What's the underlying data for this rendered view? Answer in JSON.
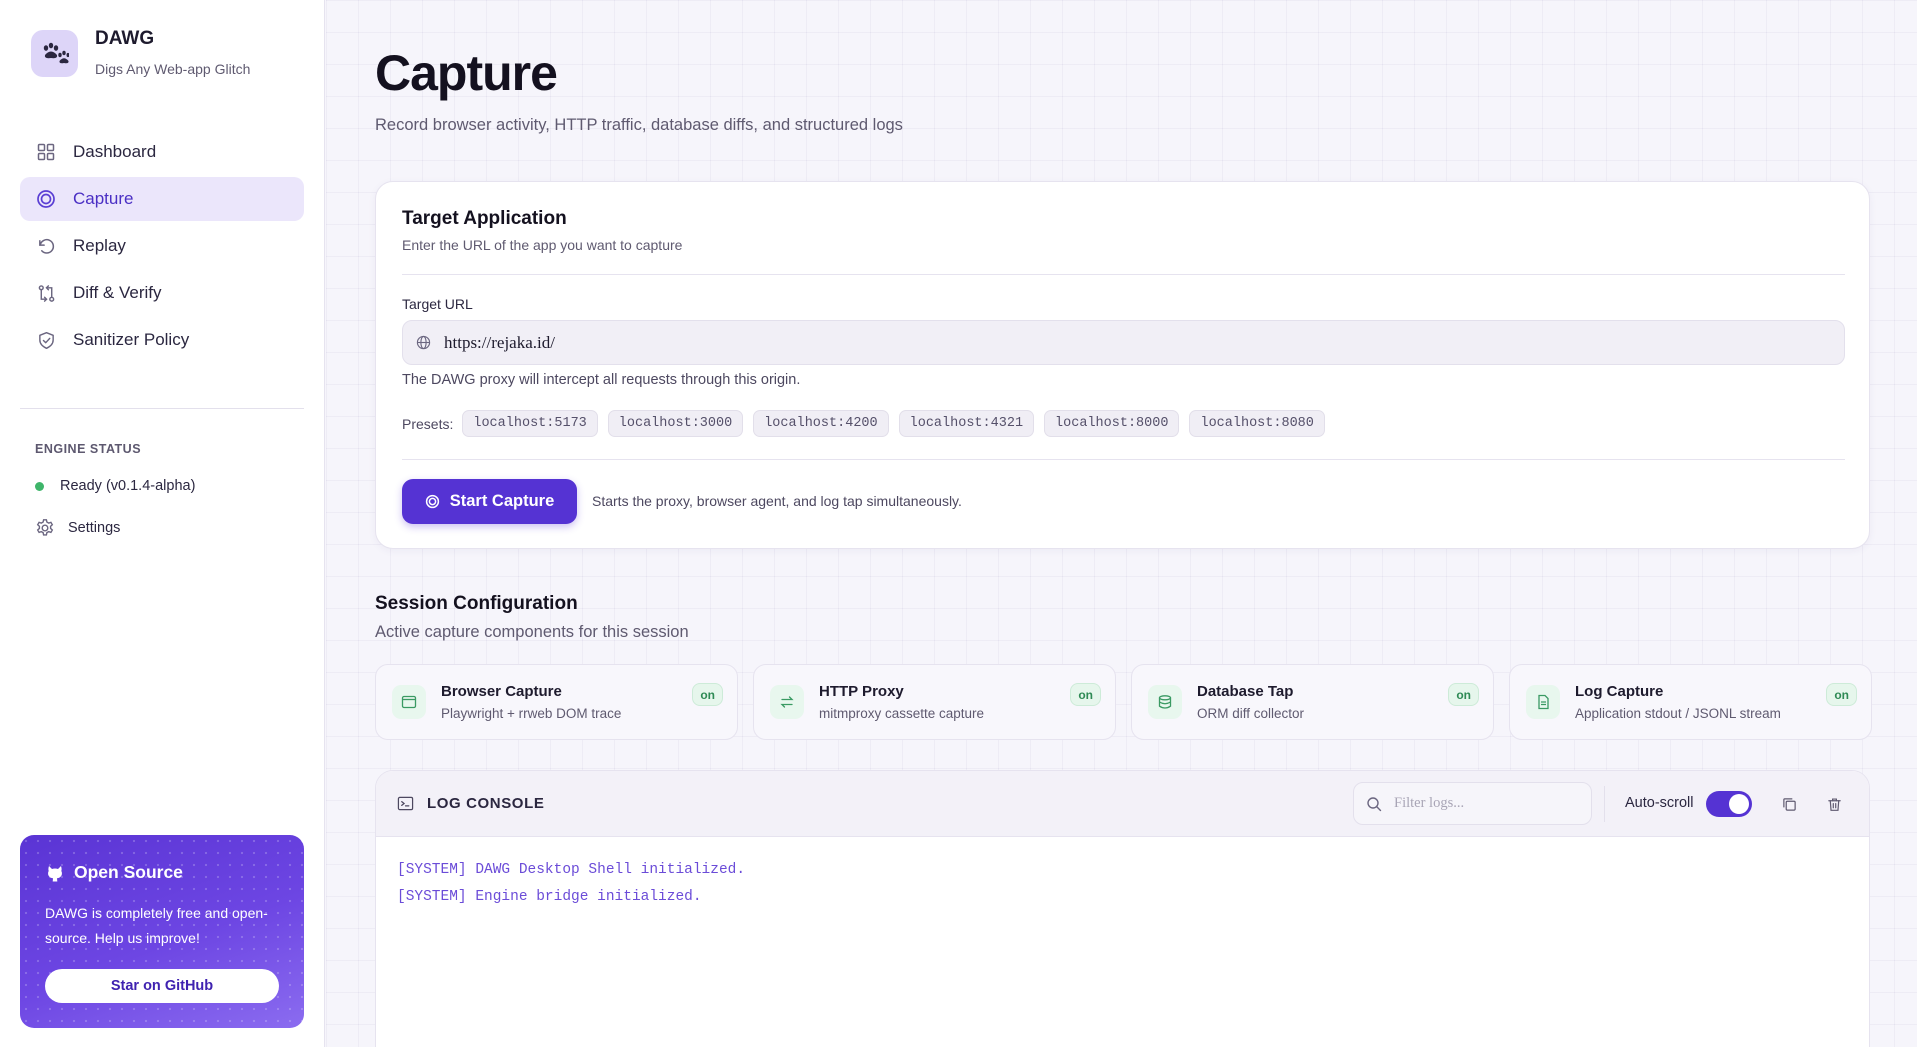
{
  "brand": {
    "name": "DAWG",
    "tagline": "Digs Any Web-app Glitch"
  },
  "nav": {
    "items": [
      {
        "label": "Dashboard",
        "icon": "grid-icon",
        "active": false
      },
      {
        "label": "Capture",
        "icon": "target-icon",
        "active": true
      },
      {
        "label": "Replay",
        "icon": "rotate-ccw-icon",
        "active": false
      },
      {
        "label": "Diff & Verify",
        "icon": "git-compare-icon",
        "active": false
      },
      {
        "label": "Sanitizer Policy",
        "icon": "shield-check-icon",
        "active": false
      }
    ]
  },
  "engine": {
    "title": "ENGINE STATUS",
    "status": "Ready (v0.1.4-alpha)",
    "status_color": "#3fb56a",
    "settings_label": "Settings"
  },
  "open_source": {
    "title": "Open Source",
    "body": "DAWG is completely free and open-source. Help us improve!",
    "button": "Star on GitHub"
  },
  "page": {
    "title": "Capture",
    "subtitle": "Record browser activity, HTTP traffic, database diffs, and structured logs"
  },
  "target": {
    "title": "Target Application",
    "subtitle": "Enter the URL of the app you want to capture",
    "field_label": "Target URL",
    "url_value": "https://rejaka.id/",
    "hint": "The DAWG proxy will intercept all requests through this origin.",
    "presets_label": "Presets:",
    "presets": [
      "localhost:5173",
      "localhost:3000",
      "localhost:4200",
      "localhost:4321",
      "localhost:8000",
      "localhost:8080"
    ],
    "start_button": "Start Capture",
    "start_hint": "Starts the proxy, browser agent, and log tap simultaneously."
  },
  "session": {
    "title": "Session Configuration",
    "subtitle": "Active capture components for this session",
    "components": [
      {
        "name": "Browser Capture",
        "desc": "Playwright + rrweb DOM trace",
        "badge": "on",
        "icon": "browser-window-icon"
      },
      {
        "name": "HTTP Proxy",
        "desc": "mitmproxy cassette capture",
        "badge": "on",
        "icon": "arrows-exchange-icon"
      },
      {
        "name": "Database Tap",
        "desc": "ORM diff collector",
        "badge": "on",
        "icon": "database-icon"
      },
      {
        "name": "Log Capture",
        "desc": "Application stdout / JSONL stream",
        "badge": "on",
        "icon": "file-text-icon"
      }
    ]
  },
  "console": {
    "title": "LOG CONSOLE",
    "filter_placeholder": "Filter logs...",
    "autoscroll_label": "Auto-scroll",
    "autoscroll_on": true,
    "lines": [
      "[SYSTEM] DAWG Desktop Shell initialized.",
      "[SYSTEM] Engine bridge initialized."
    ]
  },
  "colors": {
    "accent": "#5533d3",
    "active_nav_bg": "#ebe6fb",
    "status_green": "#3fb56a"
  }
}
